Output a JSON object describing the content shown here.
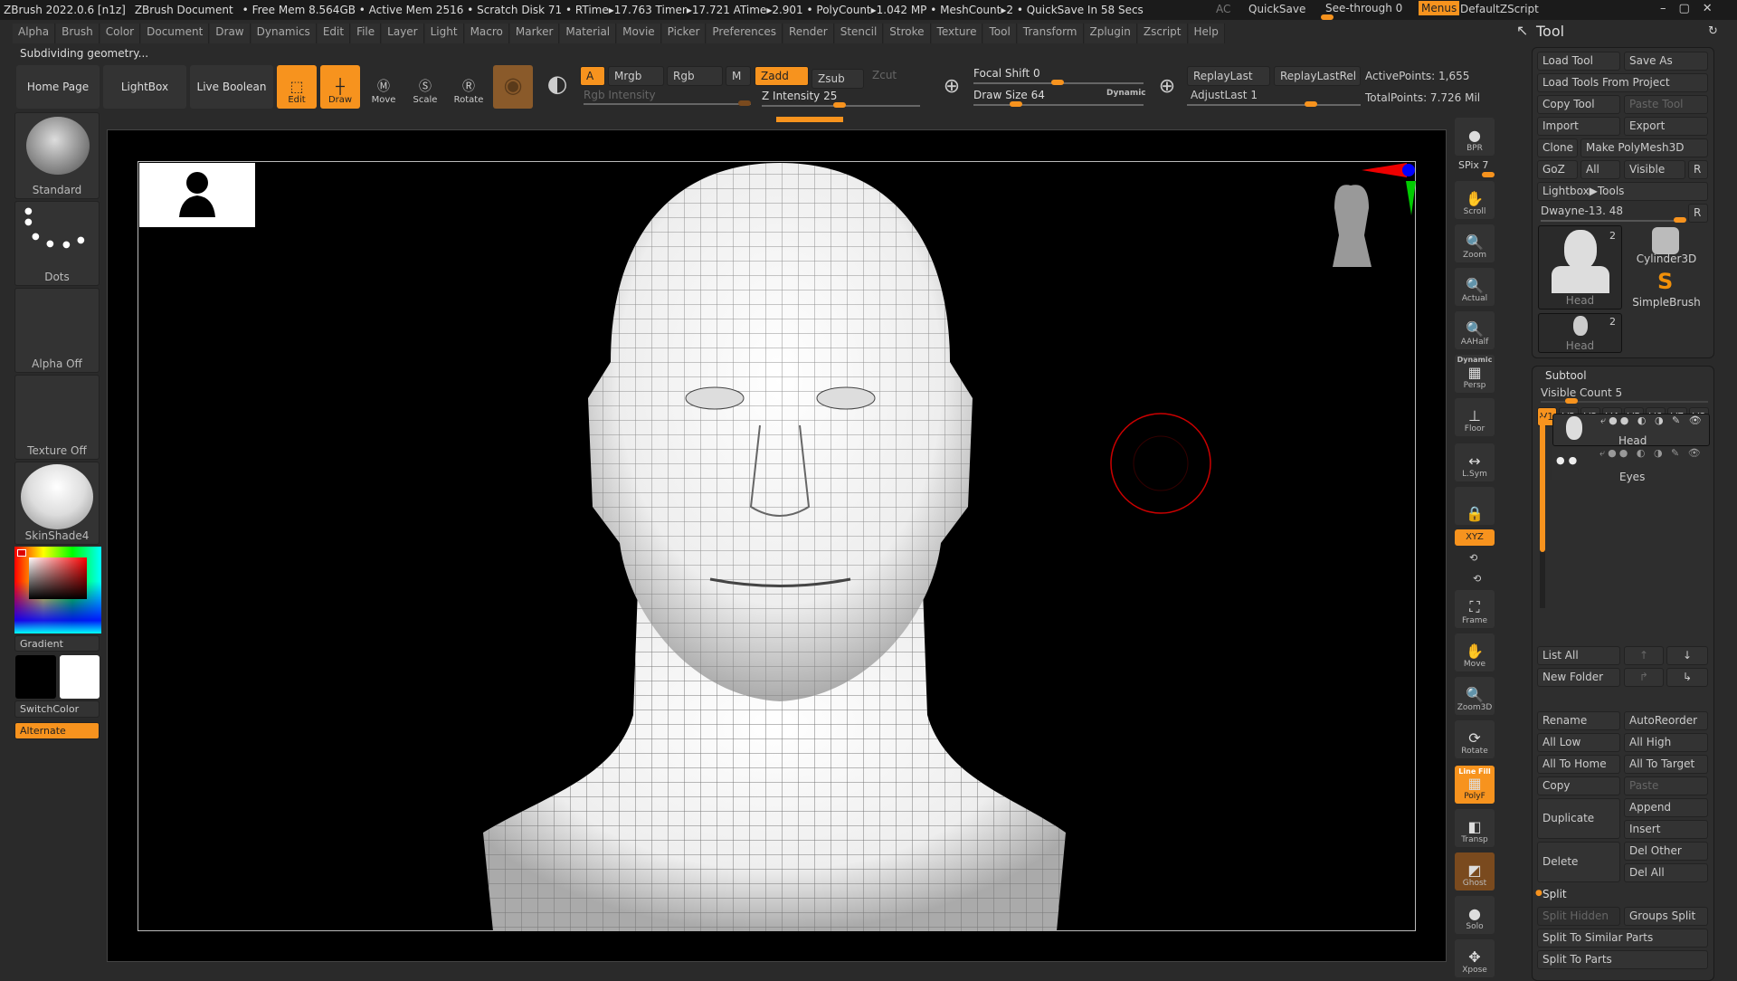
{
  "titlebar": {
    "app": "ZBrush 2022.0.6 [n1z]",
    "doc": "ZBrush Document",
    "stats": "• Free Mem 8.564GB • Active Mem 2516 • Scratch Disk 71 • RTime▸17.763 Timer▸17.721 ATime▸2.901 • PolyCount▸1.042 MP • MeshCount▸2 • QuickSave In 58 Secs",
    "ac": "AC",
    "quicksave": "QuickSave",
    "seethrough": "See-through 0",
    "menus": "Menus",
    "script": "DefaultZScript"
  },
  "menu": [
    "Alpha",
    "Brush",
    "Color",
    "Document",
    "Draw",
    "Dynamics",
    "Edit",
    "File",
    "Layer",
    "Light",
    "Macro",
    "Marker",
    "Material",
    "Movie",
    "Picker",
    "Preferences",
    "Render",
    "Stencil",
    "Stroke",
    "Texture",
    "Tool",
    "Transform",
    "Zplugin",
    "Zscript",
    "Help"
  ],
  "status": "Subdividing geometry...",
  "toolbar": {
    "home": "Home Page",
    "lightbox": "LightBox",
    "liveboolean": "Live Boolean",
    "edit": "Edit",
    "draw": "Draw",
    "move": "Move",
    "scale": "Scale",
    "rotate": "Rotate",
    "a": "A",
    "mrgb": "Mrgb",
    "rgb": "Rgb",
    "m": "M",
    "zadd": "Zadd",
    "zsub": "Zsub",
    "zcut": "Zcut",
    "rgb_intensity": "Rgb Intensity",
    "z_intensity": "Z Intensity 25",
    "focal_shift": "Focal Shift 0",
    "draw_size": "Draw Size 64",
    "dynamic": "Dynamic",
    "replaylast": "ReplayLast",
    "replaylastrel": "ReplayLastRel",
    "adjustlast": "AdjustLast 1",
    "activepoints": "ActivePoints: 1,655",
    "totalpoints": "TotalPoints: 7.726 Mil",
    "z_intensity_value": 25,
    "focal_shift_value": 0,
    "draw_size_value": 64
  },
  "left": {
    "brush": "Standard",
    "stroke": "Dots",
    "alpha": "Alpha Off",
    "texture": "Texture Off",
    "material": "SkinShade4",
    "gradient": "Gradient",
    "switchcolor": "SwitchColor",
    "alternate": "Alternate"
  },
  "shelf": [
    {
      "label": "BPR",
      "icon": "bpr-icon"
    },
    {
      "label": "Scroll",
      "icon": "scroll-icon"
    },
    {
      "label": "Zoom",
      "icon": "zoom-icon"
    },
    {
      "label": "Actual",
      "icon": "actual-icon"
    },
    {
      "label": "AAHalf",
      "icon": "aahalf-icon"
    },
    {
      "label": "Persp",
      "icon": "persp-icon"
    },
    {
      "label": "Floor",
      "icon": "floor-icon"
    },
    {
      "label": "L.Sym",
      "icon": "lsym-icon"
    },
    {
      "label": "",
      "icon": "lock-camera-icon"
    },
    {
      "label": "Frame",
      "icon": "frame-icon"
    },
    {
      "label": "Move",
      "icon": "move-icon"
    },
    {
      "label": "Zoom3D",
      "icon": "zoom3d-icon"
    },
    {
      "label": "Rotate",
      "icon": "rotate-icon"
    },
    {
      "label": "PolyF",
      "icon": "polyf-icon"
    },
    {
      "label": "Transp",
      "icon": "transp-icon"
    },
    {
      "label": "Ghost",
      "icon": "ghost-icon"
    },
    {
      "label": "Solo",
      "icon": "solo-icon"
    },
    {
      "label": "Xpose",
      "icon": "xpose-icon"
    }
  ],
  "shelf_extra": {
    "spix": "SPix 7",
    "xyz": "XYZ",
    "dynamic": "Dynamic",
    "linefill": "Line Fill"
  },
  "tool": {
    "title": "Tool",
    "load": "Load Tool",
    "saveas": "Save As",
    "loadproject": "Load Tools From Project",
    "copy": "Copy Tool",
    "paste": "Paste Tool",
    "import": "Import",
    "export": "Export",
    "clone": "Clone",
    "makepoly": "Make PolyMesh3D",
    "goz": "GoZ",
    "all": "All",
    "visible": "Visible",
    "r": "R",
    "lightbox": "Lightbox▶Tools",
    "current": "Dwayne-13. 48",
    "thumbs": [
      {
        "label": "Head",
        "count": "2"
      },
      {
        "label": "Cylinder3D"
      },
      {
        "label": "SimpleBrush"
      },
      {
        "label": "Head",
        "count": "2"
      }
    ]
  },
  "subtool": {
    "title": "Subtool",
    "visible_count": "Visible Count 5",
    "versions": [
      "V1",
      "V2",
      "V3",
      "V4",
      "V5",
      "V6",
      "V7",
      "V8"
    ],
    "items": [
      "Head",
      "Eyes"
    ],
    "listall": "List All",
    "newfolder": "New Folder",
    "rename": "Rename",
    "autoreorder": "AutoReorder",
    "alllow": "All Low",
    "allhigh": "All High",
    "alltohome": "All To Home",
    "alltotarget": "All To Target",
    "copy": "Copy",
    "paste": "Paste",
    "duplicate": "Duplicate",
    "append": "Append",
    "insert": "Insert",
    "delete": "Delete",
    "delother": "Del Other",
    "delall": "Del All",
    "split": "Split",
    "splithidden": "Split Hidden",
    "groupssplit": "Groups Split",
    "splitsimilar": "Split To Similar Parts",
    "splitparts": "Split To Parts"
  },
  "colors": {
    "accent": "#f7931e",
    "bg": "#2a2a2a"
  }
}
